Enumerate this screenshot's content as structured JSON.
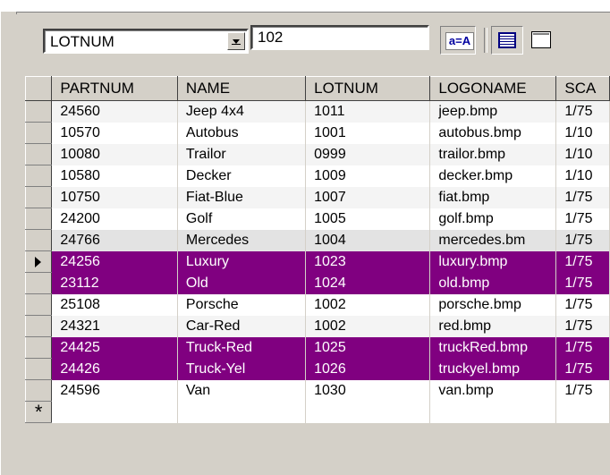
{
  "toolbar": {
    "field_select": "LOTNUM",
    "search_value": "102",
    "case_button_label": "a=A",
    "icons": [
      "chevron-down-icon",
      "case-sensitive-icon",
      "grid-view-icon",
      "form-view-icon"
    ]
  },
  "table": {
    "columns": [
      "PARTNUM",
      "NAME",
      "LOTNUM",
      "LOGONAME",
      "SCA"
    ],
    "rows": [
      {
        "PARTNUM": "24560",
        "NAME": "Jeep 4x4",
        "LOTNUM": "1011",
        "LOGONAME": "jeep.bmp",
        "SCA": "1/75",
        "style": "light"
      },
      {
        "PARTNUM": "10570",
        "NAME": "Autobus",
        "LOTNUM": "1001",
        "LOGONAME": "autobus.bmp",
        "SCA": "1/10",
        "style": "white"
      },
      {
        "PARTNUM": "10080",
        "NAME": "Trailor",
        "LOTNUM": "0999",
        "LOGONAME": "trailor.bmp",
        "SCA": "1/10",
        "style": "light"
      },
      {
        "PARTNUM": "10580",
        "NAME": "Decker",
        "LOTNUM": "1009",
        "LOGONAME": "decker.bmp",
        "SCA": "1/10",
        "style": "white"
      },
      {
        "PARTNUM": "10750",
        "NAME": "Fiat-Blue",
        "LOTNUM": "1007",
        "LOGONAME": "fiat.bmp",
        "SCA": "1/75",
        "style": "light"
      },
      {
        "PARTNUM": "24200",
        "NAME": "Golf",
        "LOTNUM": "1005",
        "LOGONAME": "golf.bmp",
        "SCA": "1/75",
        "style": "white"
      },
      {
        "PARTNUM": "24766",
        "NAME": "Mercedes",
        "LOTNUM": "1004",
        "LOGONAME": "mercedes.bm",
        "SCA": "1/75",
        "style": "gray"
      },
      {
        "PARTNUM": "24256",
        "NAME": "Luxury",
        "LOTNUM": "1023",
        "LOGONAME": "luxury.bmp",
        "SCA": "1/75",
        "style": "sel",
        "current": true
      },
      {
        "PARTNUM": "23112",
        "NAME": "Old",
        "LOTNUM": "1024",
        "LOGONAME": "old.bmp",
        "SCA": "1/75",
        "style": "sel"
      },
      {
        "PARTNUM": "25108",
        "NAME": "Porsche",
        "LOTNUM": "1002",
        "LOGONAME": "porsche.bmp",
        "SCA": "1/75",
        "style": "white"
      },
      {
        "PARTNUM": "24321",
        "NAME": "Car-Red",
        "LOTNUM": "1002",
        "LOGONAME": "red.bmp",
        "SCA": "1/75",
        "style": "light"
      },
      {
        "PARTNUM": "24425",
        "NAME": "Truck-Red",
        "LOTNUM": "1025",
        "LOGONAME": "truckRed.bmp",
        "SCA": "1/75",
        "style": "sel"
      },
      {
        "PARTNUM": "24426",
        "NAME": "Truck-Yel",
        "LOTNUM": "1026",
        "LOGONAME": "truckyel.bmp",
        "SCA": "1/75",
        "style": "sel"
      },
      {
        "PARTNUM": "24596",
        "NAME": "Van",
        "LOTNUM": "1030",
        "LOGONAME": "van.bmp",
        "SCA": "1/75",
        "style": "white"
      }
    ],
    "new_row_marker": "*"
  },
  "colors": {
    "highlight": "#800080",
    "face": "#d4d0c8"
  }
}
